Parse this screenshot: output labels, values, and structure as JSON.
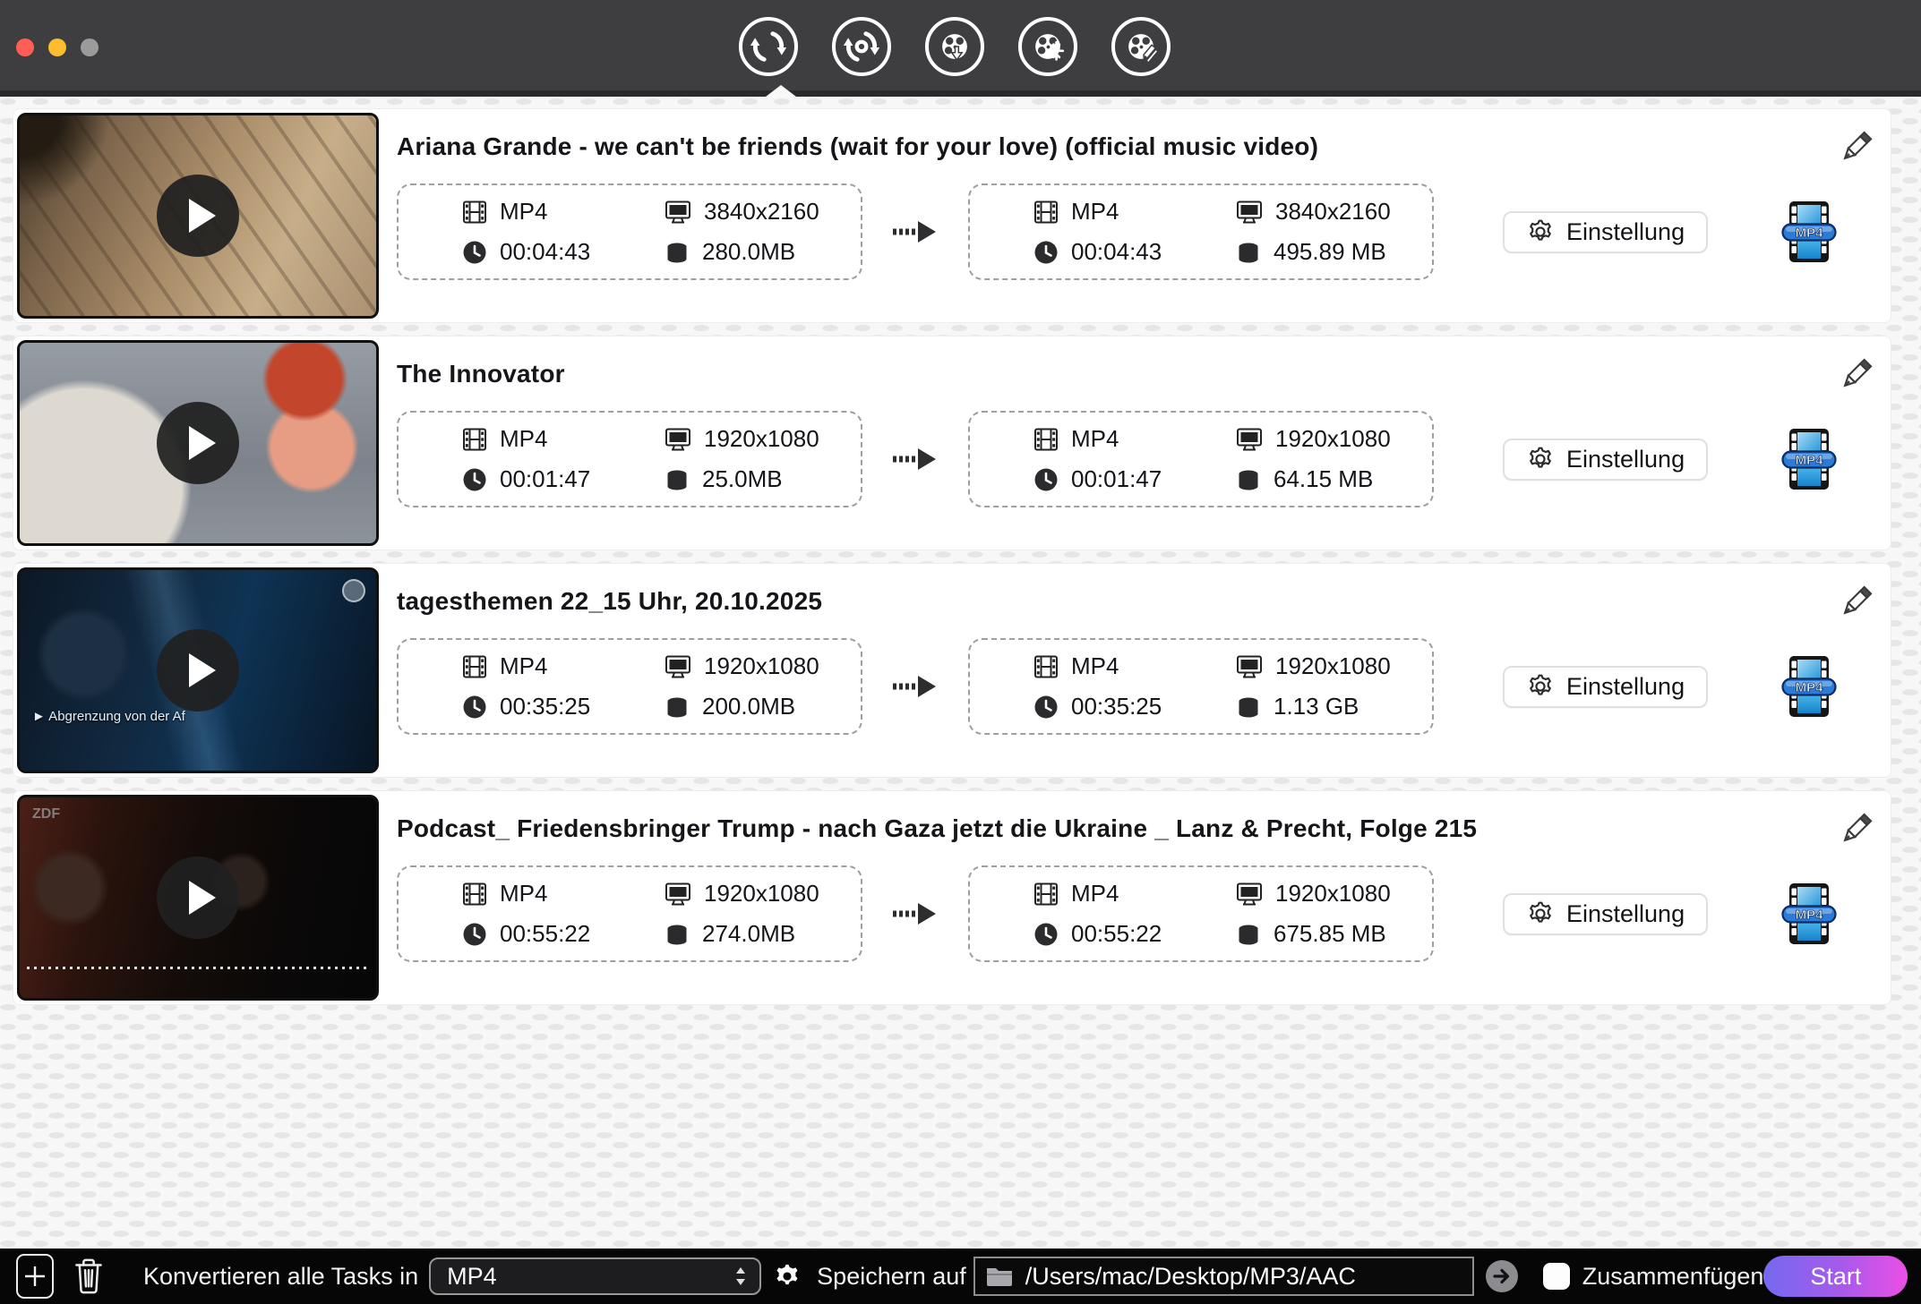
{
  "titlebar": {
    "traffic_lights": [
      "close",
      "minimize",
      "zoom"
    ],
    "toolbar_icons": [
      "convert-icon",
      "transcode-settings-icon",
      "video-download-icon",
      "video-compress-icon",
      "video-edit-icon"
    ],
    "active_tool_index": 0
  },
  "rows": [
    {
      "title": "Ariana Grande - we can't be friends (wait for your love) (official music video)",
      "source": {
        "format": "MP4",
        "resolution": "3840x2160",
        "duration": "00:04:43",
        "size": "280.0MB"
      },
      "target": {
        "format": "MP4",
        "resolution": "3840x2160",
        "duration": "00:04:43",
        "size": "495.89 MB"
      },
      "settings_label": "Einstellung",
      "badge_label": "MP4"
    },
    {
      "title": "The Innovator",
      "source": {
        "format": "MP4",
        "resolution": "1920x1080",
        "duration": "00:01:47",
        "size": "25.0MB"
      },
      "target": {
        "format": "MP4",
        "resolution": "1920x1080",
        "duration": "00:01:47",
        "size": "64.15 MB"
      },
      "settings_label": "Einstellung",
      "badge_label": "MP4"
    },
    {
      "title": "tagesthemen 22_15 Uhr, 20.10.2025",
      "source": {
        "format": "MP4",
        "resolution": "1920x1080",
        "duration": "00:35:25",
        "size": "200.0MB"
      },
      "target": {
        "format": "MP4",
        "resolution": "1920x1080",
        "duration": "00:35:25",
        "size": "1.13 GB"
      },
      "settings_label": "Einstellung",
      "badge_label": "MP4",
      "thumb_caption": "► Abgrenzung von der Af"
    },
    {
      "title": "Podcast_ Friedensbringer Trump - nach Gaza jetzt die Ukraine  _ Lanz & Precht, Folge 215",
      "source": {
        "format": "MP4",
        "resolution": "1920x1080",
        "duration": "00:55:22",
        "size": "274.0MB"
      },
      "target": {
        "format": "MP4",
        "resolution": "1920x1080",
        "duration": "00:55:22",
        "size": "675.85 MB"
      },
      "settings_label": "Einstellung",
      "badge_label": "MP4",
      "watermark": "ZDF"
    }
  ],
  "footer": {
    "convert_label": "Konvertieren alle Tasks in",
    "format_value": "MP4",
    "save_label": "Speichern auf",
    "path_value": "/Users/mac/Desktop/MP3/AAC",
    "merge_label": "Zusammenfügen",
    "merge_checked": false,
    "start_label": "Start",
    "start_gradient": [
      "#7569f0",
      "#ec4fe5"
    ],
    "bar_color": "#060606"
  }
}
